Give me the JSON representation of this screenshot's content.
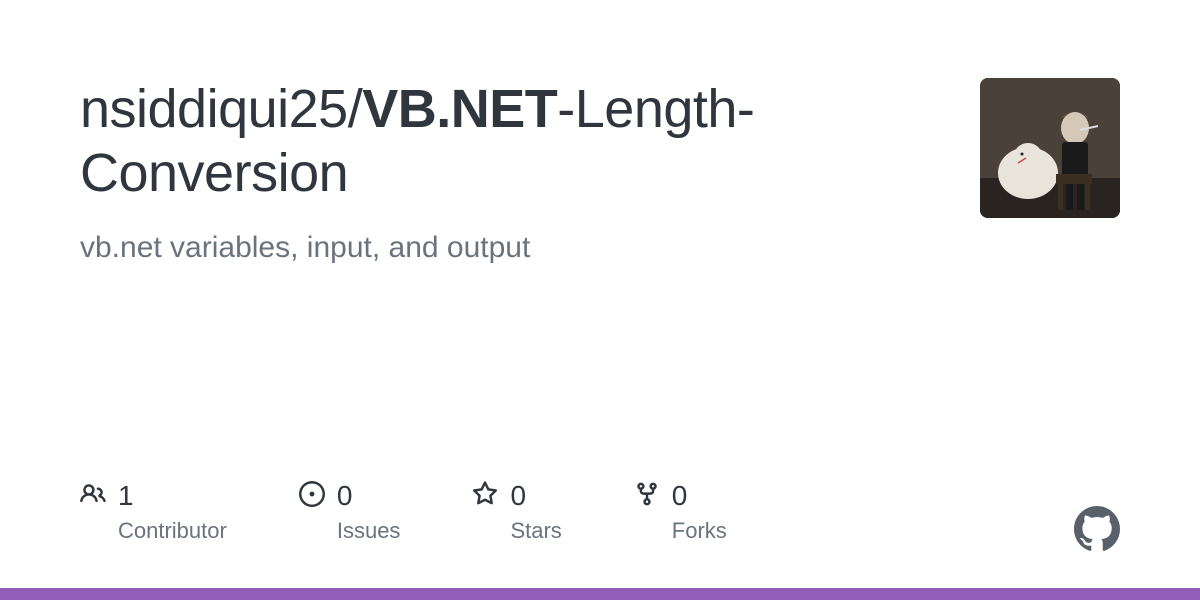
{
  "repo": {
    "owner": "nsiddiqui25",
    "separator": "/",
    "name_strong": "VB.NET",
    "name_rest": "-Length-Conversion",
    "description": "vb.net variables, input, and output"
  },
  "stats": {
    "contributors": {
      "count": "1",
      "label": "Contributor"
    },
    "issues": {
      "count": "0",
      "label": "Issues"
    },
    "stars": {
      "count": "0",
      "label": "Stars"
    },
    "forks": {
      "count": "0",
      "label": "Forks"
    }
  }
}
